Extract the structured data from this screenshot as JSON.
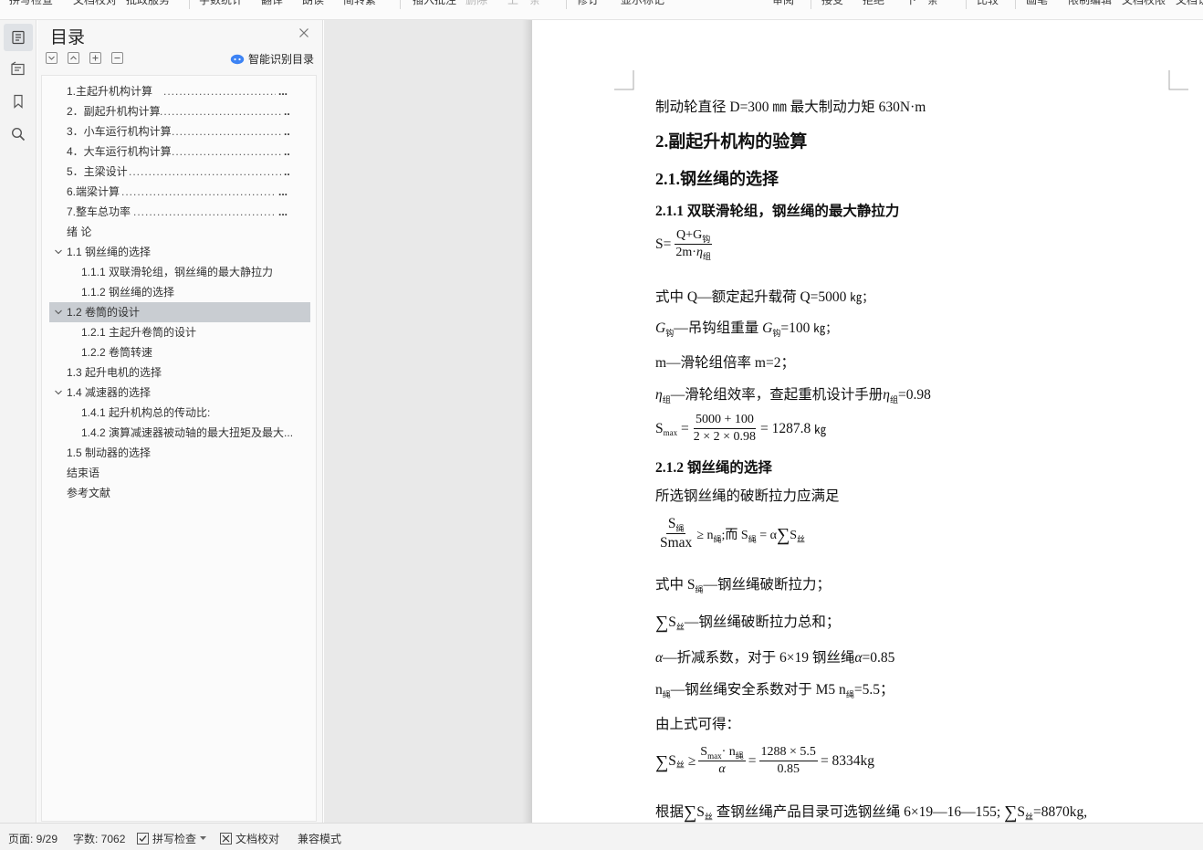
{
  "toolbar": {
    "items": [
      {
        "label": "拼写检查",
        "disabled": false
      },
      {
        "label": "文档校对",
        "disabled": false
      },
      {
        "label": "批政服务",
        "disabled": false
      },
      {
        "label": "字数统计",
        "disabled": false
      },
      {
        "label": "翻译",
        "disabled": false
      },
      {
        "label": "朗读",
        "disabled": false
      },
      {
        "label": "简转繁",
        "disabled": false
      },
      {
        "label": "插入批注",
        "disabled": false
      },
      {
        "label": "删除",
        "disabled": true
      },
      {
        "label": "上一条",
        "disabled": true
      },
      {
        "label": "修订",
        "disabled": false
      },
      {
        "label": "显示标记",
        "disabled": false
      },
      {
        "label": "审阅",
        "disabled": false
      },
      {
        "label": "接受",
        "disabled": false
      },
      {
        "label": "拒绝",
        "disabled": false
      },
      {
        "label": "下一条",
        "disabled": false
      },
      {
        "label": "比较",
        "disabled": false
      },
      {
        "label": "画笔",
        "disabled": false
      },
      {
        "label": "限制编辑",
        "disabled": false
      },
      {
        "label": "文档权限",
        "disabled": false
      },
      {
        "label": "文档认证",
        "disabled": false
      }
    ]
  },
  "toc": {
    "title": "目录",
    "smart_label": "智能识别目录",
    "items": [
      {
        "text": "1.主起升机构计算",
        "leader": true,
        "level": 1
      },
      {
        "text": "2．副起升机构计算",
        "leader": true,
        "level": 1
      },
      {
        "text": "3．小车运行机构计算",
        "leader": true,
        "level": 1
      },
      {
        "text": "4．大车运行机构计算",
        "leader": true,
        "level": 1
      },
      {
        "text": "5．主梁设计",
        "leader": true,
        "level": 1
      },
      {
        "text": "6.端梁计算",
        "leader": true,
        "level": 1
      },
      {
        "text": "7.整车总功率",
        "leader": true,
        "level": 1
      },
      {
        "text": "绪  论",
        "leader": false,
        "level": 1
      },
      {
        "text": "1.1 钢丝绳的选择",
        "leader": false,
        "level": 1,
        "expanded": true
      },
      {
        "text": "1.1.1 双联滑轮组，钢丝绳的最大静拉力",
        "leader": false,
        "level": 2
      },
      {
        "text": "1.1.2 钢丝绳的选择",
        "leader": false,
        "level": 2
      },
      {
        "text": "1.2 卷筒的设计",
        "leader": false,
        "level": 1,
        "expanded": true,
        "selected": true
      },
      {
        "text": "1.2.1 主起升卷筒的设计",
        "leader": false,
        "level": 2
      },
      {
        "text": "1.2.2 卷筒转速",
        "leader": false,
        "level": 2
      },
      {
        "text": "1.3 起升电机的选择",
        "leader": false,
        "level": 1
      },
      {
        "text": "1.4 减速器的选择",
        "leader": false,
        "level": 1,
        "expanded": true
      },
      {
        "text": "1.4.1 起升机构总的传动比:",
        "leader": false,
        "level": 2
      },
      {
        "text": "1.4.2 演算减速器被动轴的最大扭矩及最大...",
        "leader": false,
        "level": 2
      },
      {
        "text": "1.5 制动器的选择",
        "leader": false,
        "level": 1
      },
      {
        "text": "结束语",
        "leader": false,
        "level": 1
      },
      {
        "text": "参考文献",
        "leader": false,
        "level": 1
      }
    ]
  },
  "document": {
    "line1": "制动轮直径 D=300 ㎜ 最大制动力矩 630N·m",
    "h_section": "2.副起升机构的验算",
    "h_sub": "2.1.钢丝绳的选择",
    "h_subsub1": "2.1.1 双联滑轮组，钢丝绳的最大静拉力",
    "f1": {
      "lhs": "S",
      "eq": "=",
      "num_a": "Q",
      "num_plus": "+",
      "num_b": "G",
      "num_b_sub": "钩",
      "den_a": "2m",
      "den_dot": "·",
      "den_eta": "η",
      "den_sub": "组"
    },
    "p_q": {
      "prefix": "式中 Q—额定起升载荷 Q=5000",
      "unit": "㎏；"
    },
    "p_g": {
      "sym": "G",
      "sub": "钩",
      "mid": "—吊钩组重量",
      "sym2": "G",
      "sub2": "钩",
      "val": "=100",
      "unit": "㎏；"
    },
    "p_m": "m—滑轮组倍率 m=2；",
    "p_eta": {
      "sym": "η",
      "sub": "组",
      "mid": "—滑轮组效率，查起重机设计手册",
      "sym2": "η",
      "sub2": "组",
      "val": "=0.98"
    },
    "f2": {
      "lhs": "S",
      "lhs_sub": "max",
      "eq": "=",
      "num": "5000 + 100",
      "den": "2 × 2 × 0.98",
      "eq2": "= 1287.8",
      "unit": "㎏"
    },
    "h_subsub2": "2.1.2 钢丝绳的选择",
    "p_rope": "所选钢丝绳的破断拉力应满足",
    "f3": {
      "num": "S",
      "num_sub": "绳",
      "den": "Smax",
      "ge": "≥ n",
      "ge_sub": "绳",
      "and": ";而 S",
      "and_sub": "绳",
      "eq": "= α",
      "sig": "∑",
      "s": "S",
      "s_sub": "丝"
    },
    "p_s": {
      "prefix": "式中 S",
      "sub": "绳",
      "rest": "—钢丝绳破断拉力；"
    },
    "p_sum": {
      "sig": "∑",
      "s": "S",
      "sub": "丝",
      "rest": "—钢丝绳破断拉力总和；"
    },
    "p_alpha": {
      "sym": "α",
      "mid": "—折减系数，对于 6×19 钢丝绳",
      "sym2": "α",
      "val": "=0.85"
    },
    "p_n": {
      "sym": "n",
      "sub": "绳",
      "mid": "—钢丝绳安全系数对于 M5  n",
      "sub2": "绳",
      "val": "=5.5；"
    },
    "p_from": "由上式可得：",
    "f4": {
      "sig": "∑",
      "s": "S",
      "sub": "丝",
      "ge": "≥",
      "num1": "S",
      "num1_sub": "max",
      "num1_dot": "· n",
      "num1_sub2": "绳",
      "den1": "α",
      "eq": "=",
      "num2": "1288 × 5.5",
      "den2": "0.85",
      "res": "= 8334kg"
    },
    "p_last": {
      "a": "根据",
      "sig": "∑",
      "s": "S",
      "sub": "丝",
      "b": "查钢丝绳产品目录可选钢丝绳 6×19—16—155;",
      "sig2": "∑",
      "s2": "S",
      "sub2": "丝",
      "c": "=8870kg,"
    }
  },
  "status": {
    "page": "页面: 9/29",
    "words": "字数: 7062",
    "spell": "拼写检查",
    "proof": "文档校对",
    "compat": "兼容模式"
  }
}
